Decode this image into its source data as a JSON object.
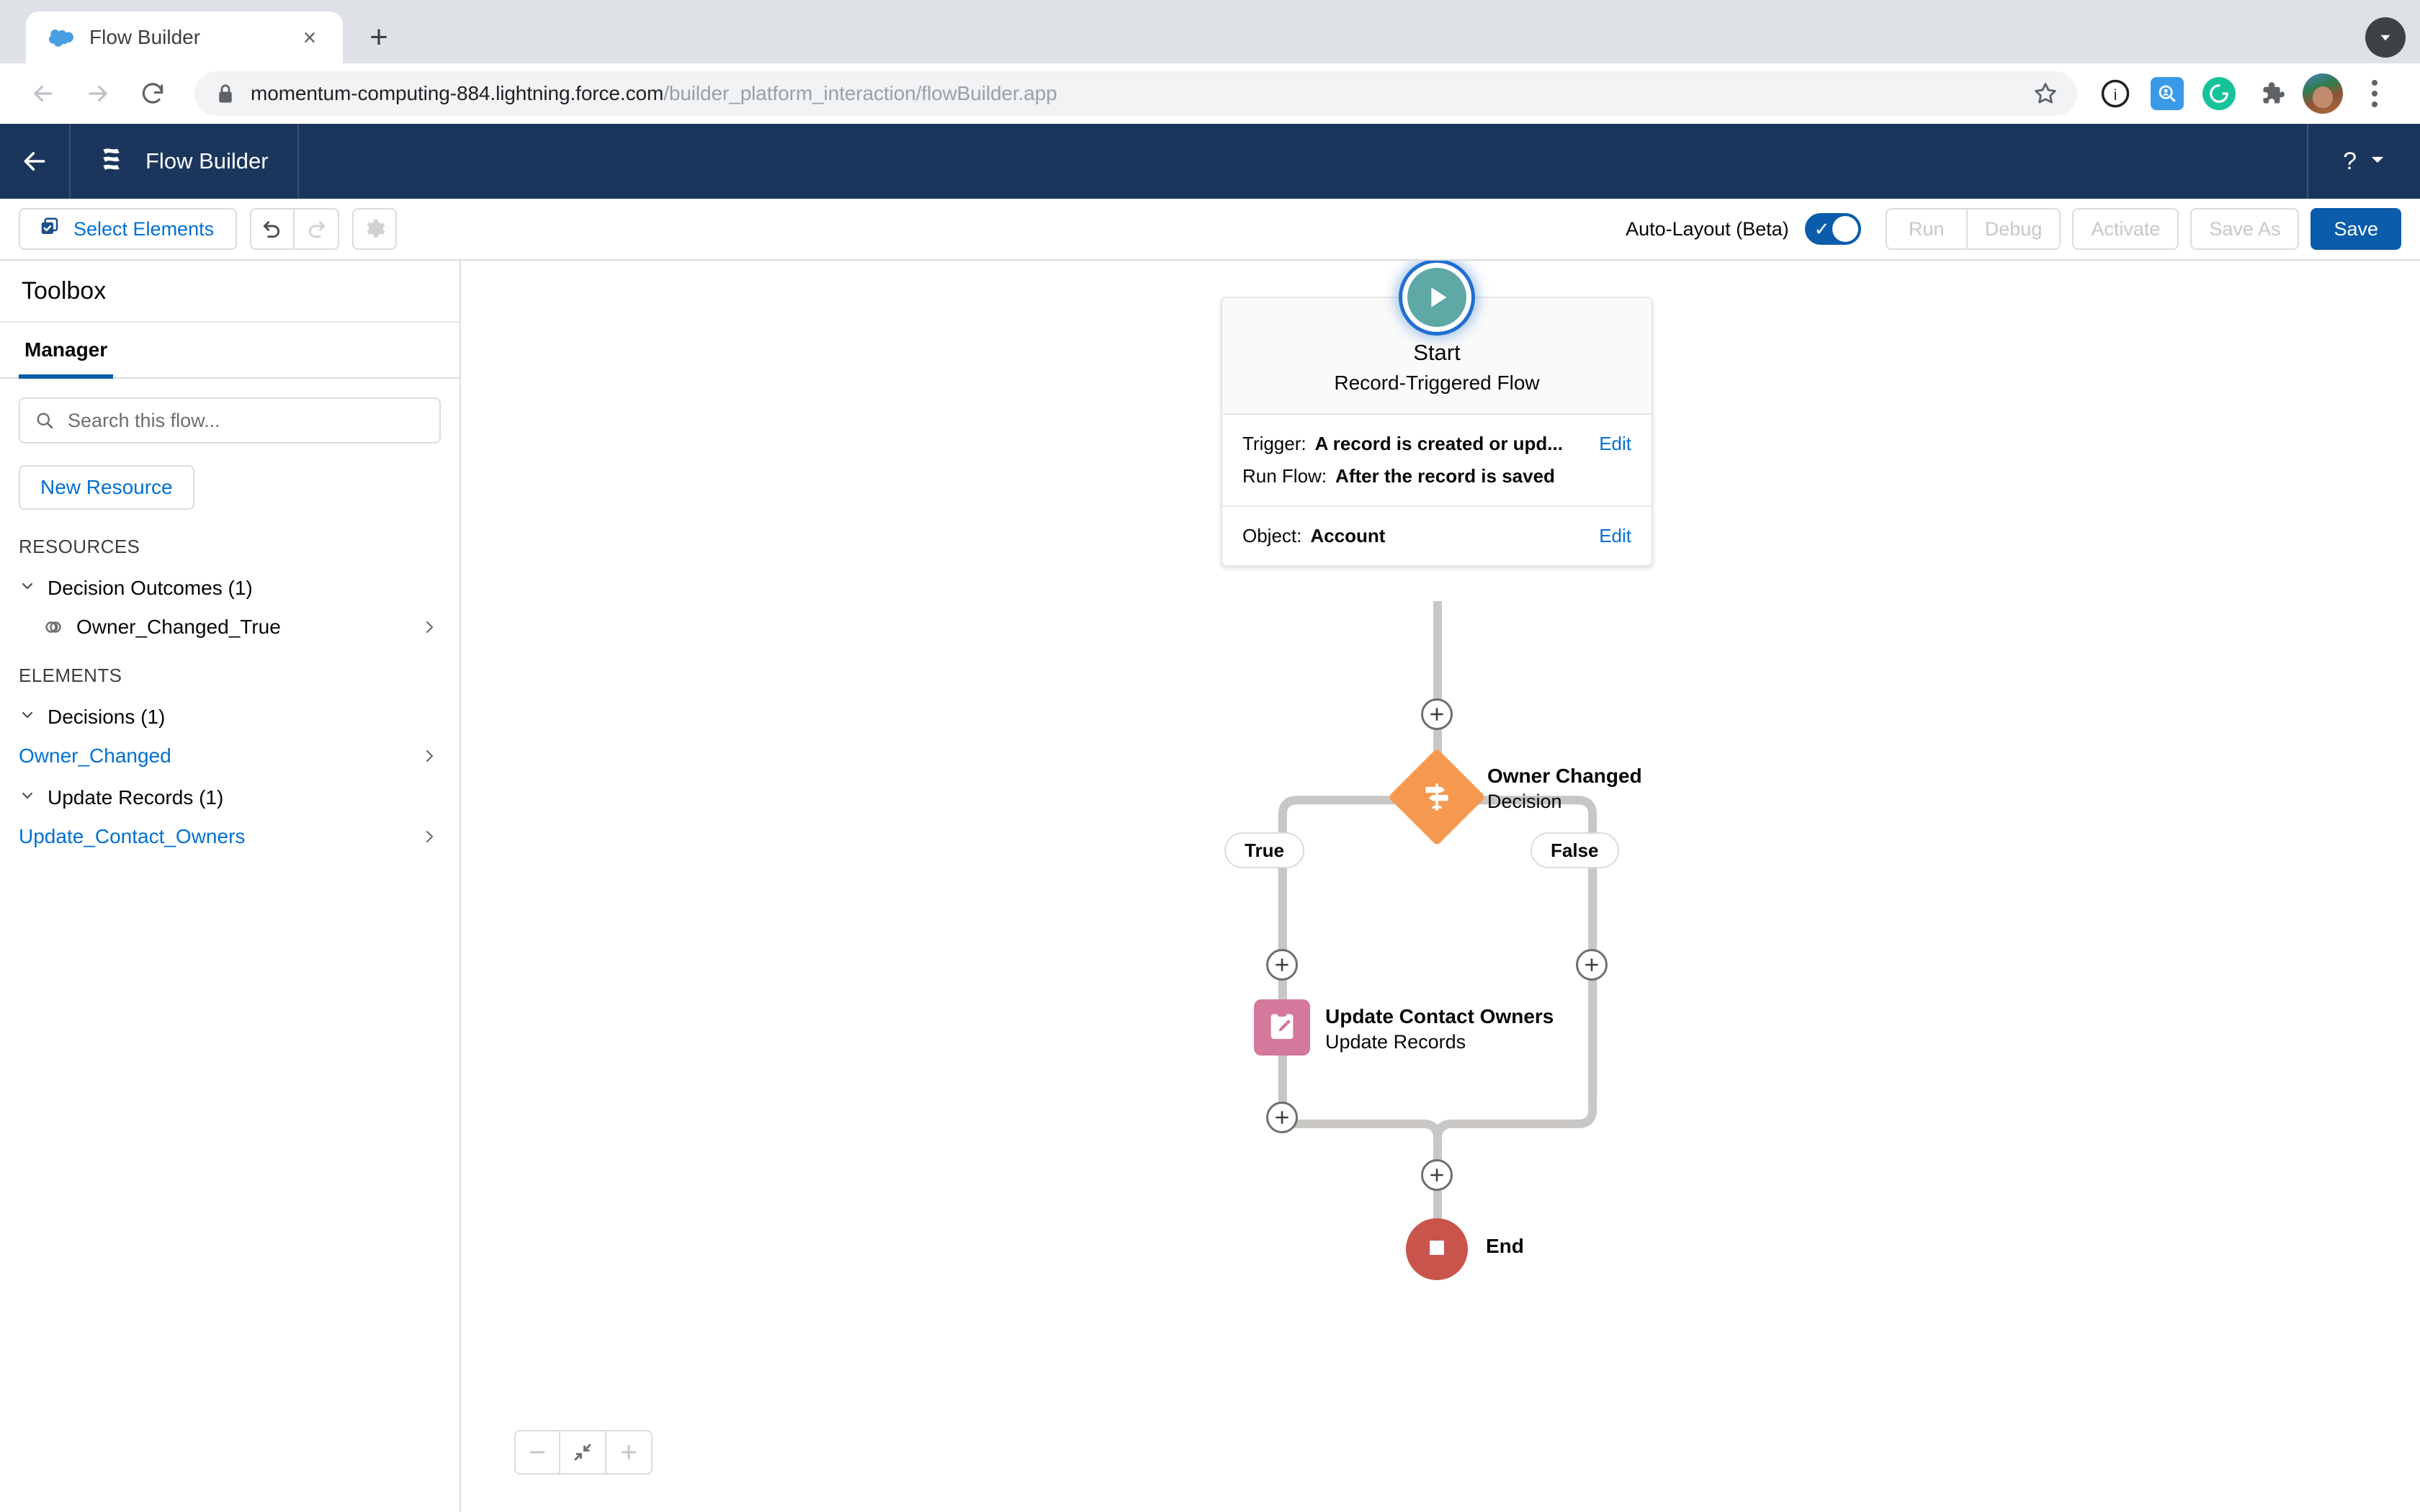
{
  "browser": {
    "tab": {
      "title": "Flow Builder",
      "favicon": "salesforce-cloud-icon",
      "close": "×"
    },
    "new_tab_label": "+",
    "url_host": "momentum-computing-884.lightning.force.com",
    "url_path": "/builder_platform_interaction/flowBuilder.app",
    "nav": {
      "back": "←",
      "forward": "→",
      "reload": "↻"
    },
    "extensions": [
      "bookmark-star-icon",
      "info-circle-icon",
      "search-extension-icon",
      "grammarly-icon",
      "puzzle-extensions-icon",
      "profile-avatar",
      "chrome-menu-icon"
    ]
  },
  "header": {
    "back_label": "←",
    "app_icon": "flow-builder-icon",
    "title": "Flow Builder",
    "help_label": "?",
    "help_caret": "▾",
    "bg_color": "#1b365d"
  },
  "toolbar": {
    "select_elements": "Select Elements",
    "undo": "undo-icon",
    "redo": "redo-icon",
    "settings": "gear-icon",
    "autolayout_label": "Auto-Layout (Beta)",
    "autolayout_on": true,
    "actions": [
      "Run",
      "Debug",
      "Activate",
      "Save As"
    ],
    "save": "Save",
    "save_color": "#0b5cab"
  },
  "sidebar": {
    "title": "Toolbox",
    "tabs": [
      {
        "label": "Manager",
        "active": true
      }
    ],
    "search_placeholder": "Search this flow...",
    "search_value": "",
    "new_resource": "New Resource",
    "sections": [
      {
        "label": "RESOURCES",
        "groups": [
          {
            "label": "Decision Outcomes (1)",
            "items": [
              {
                "label": "Owner_Changed_True",
                "icon": "outcome-circles-icon",
                "link": false
              }
            ]
          }
        ]
      },
      {
        "label": "ELEMENTS",
        "groups": [
          {
            "label": "Decisions (1)",
            "items": [
              {
                "label": "Owner_Changed",
                "icon": "",
                "link": true
              }
            ]
          },
          {
            "label": "Update Records (1)",
            "items": [
              {
                "label": "Update_Contact_Owners",
                "icon": "",
                "link": true
              }
            ]
          }
        ]
      }
    ],
    "chevron": "›"
  },
  "canvas": {
    "start": {
      "icon": "play-start-icon",
      "title": "Start",
      "subtitle": "Record-Triggered Flow",
      "rows": [
        {
          "lines": [
            {
              "key": "Trigger:",
              "value": "A record is created or upd..."
            },
            {
              "key": "Run Flow:",
              "value": "After the record is saved"
            }
          ],
          "edit": "Edit"
        },
        {
          "lines": [
            {
              "key": "Object:",
              "value": "Account"
            }
          ],
          "edit": "Edit"
        }
      ]
    },
    "decision": {
      "title": "Owner Changed",
      "subtitle": "Decision",
      "icon": "signpost-decision-icon",
      "color": "#f4994f",
      "branches": [
        {
          "label": "True"
        },
        {
          "label": "False"
        }
      ]
    },
    "update_records": {
      "title": "Update Contact Owners",
      "subtitle": "Update Records",
      "icon": "clipboard-pencil-icon",
      "color": "#d4799b"
    },
    "end": {
      "label": "End",
      "icon": "stop-square-icon",
      "color": "#c9544b"
    },
    "add_buttons": [
      "+",
      "+",
      "+",
      "+",
      "+"
    ],
    "zoom_controls": {
      "out": "zoom-out-icon",
      "fit": "fit-to-view-icon",
      "in": "zoom-in-icon"
    }
  }
}
